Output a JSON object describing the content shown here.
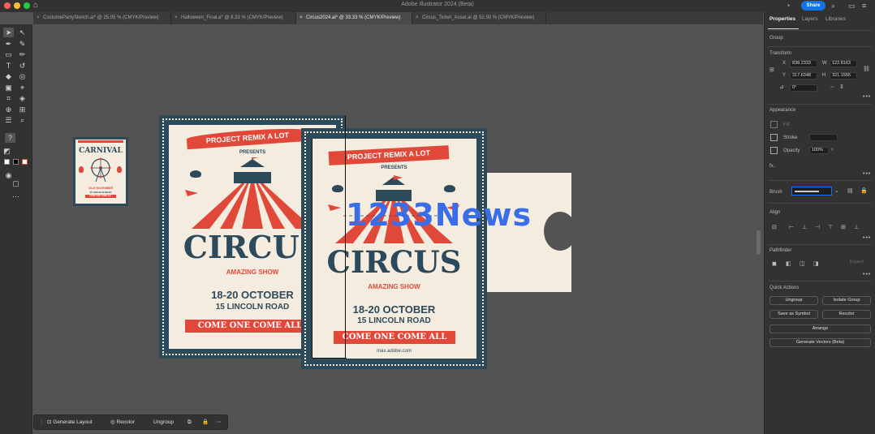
{
  "window": {
    "title": "Adobe Illustrator 2024 (Beta)",
    "share_label": "Share"
  },
  "tabs": [
    {
      "label": "CostumePartySketch.ai* @ 25.05 % (CMYK/Preview)",
      "active": false
    },
    {
      "label": "Halloween_Final.a* @ 8.33 % (CMYK/Preview)",
      "active": false
    },
    {
      "label": "Circus2024.ai* @ 33.33 % (CMYK/Preview)",
      "active": true
    },
    {
      "label": "Circus_Ticket_Asset.ai @ 52.50 % (CMYK/Preview)",
      "active": false
    }
  ],
  "artwork": {
    "poster_banner": "PROJECT REMIX A LOT",
    "presents": "PRESENTS",
    "circus": "CIRCUS",
    "amazing_show": "AMAZING SHOW",
    "dates": "18-20 OCTOBER",
    "address": "15 LINCOLN ROAD",
    "come_one": "COME ONE   COME ALL",
    "url": "max.adobe.com",
    "thumb_title": "CARNIVAL",
    "thumb_dates": "18-20 NOVEMBER",
    "thumb_address": "15 LINCOLN ROAD",
    "thumb_cta": "COME ONE COME ALL"
  },
  "watermark": "1233News",
  "taskbar": {
    "generate_layout": "Generate Layout",
    "recolor": "Recolor",
    "ungroup": "Ungroup"
  },
  "panel": {
    "tabs": [
      "Properties",
      "Layers",
      "Libraries"
    ],
    "selection": "Group",
    "transform": {
      "title": "Transform",
      "x_label": "X",
      "x": "838.2333",
      "y_label": "Y",
      "y": "317.6348",
      "w_label": "W",
      "w": "122.8163",
      "h_label": "H",
      "h": "321.1555",
      "rotate": "0°"
    },
    "appearance": {
      "title": "Appearance",
      "fill": "Fill",
      "stroke": "Stroke",
      "opacity_label": "Opacity",
      "opacity": "100%",
      "fx": "fx."
    },
    "brush_label": "Brush",
    "align_title": "Align",
    "pathfinder_title": "Pathfinder",
    "pathfinder_expand": "Expand",
    "quick_actions": {
      "title": "Quick Actions",
      "ungroup": "Ungroup",
      "isolate": "Isolate Group",
      "save_symbol": "Save as Symbol",
      "recolor": "Recolor",
      "arrange": "Arrange",
      "generate_vectors": "Generate Vectors (Beta)"
    }
  },
  "colors": {
    "poster_navy": "#2d4a5a",
    "poster_cream": "#f5ece0",
    "poster_red": "#e0493a",
    "accent_blue": "#1473e6",
    "watermark_blue": "#3a6ee8"
  }
}
